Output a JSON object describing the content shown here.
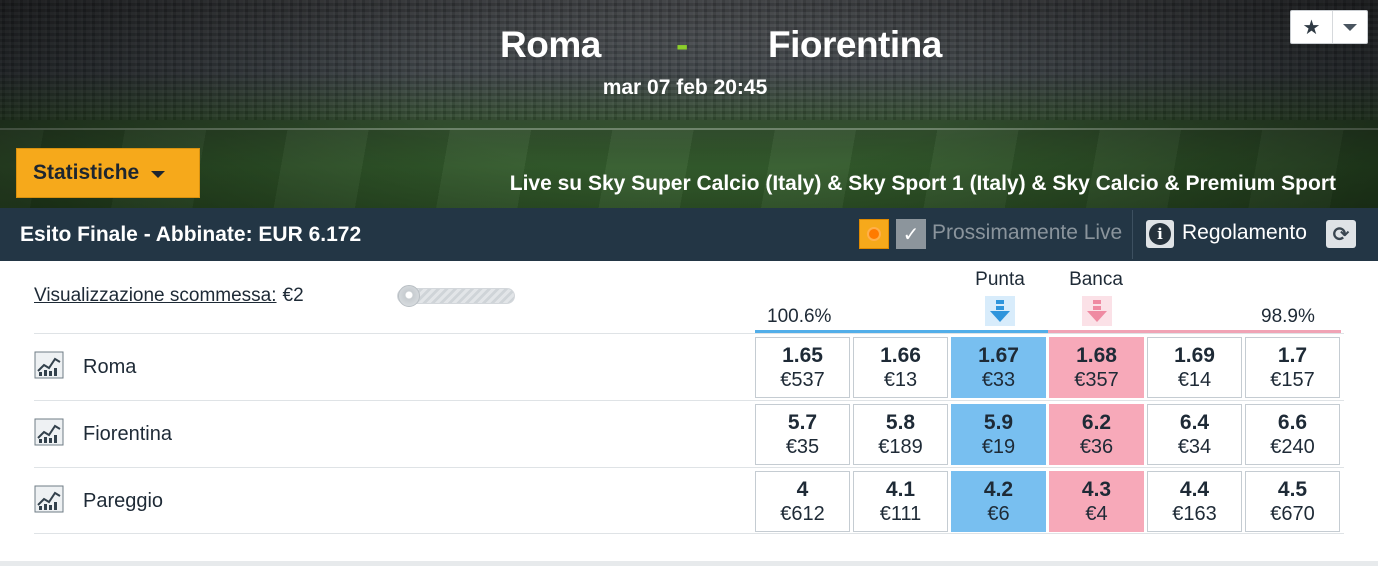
{
  "header": {
    "home_team": "Roma",
    "separator": "-",
    "away_team": "Fiorentina",
    "date": "mar 07 feb 20:45",
    "stats_button": "Statistiche",
    "live_info": "Live su Sky Super Calcio (Italy) & Sky Sport 1 (Italy) & Sky Calcio & Premium Sport",
    "fav_icon": "★"
  },
  "market": {
    "title": "Esito Finale - Abbinate: EUR 6.172",
    "soon_live": "Prossimamente Live",
    "rules": "Regolamento",
    "info_glyph": "i",
    "refresh_glyph": "⟳",
    "check_glyph": "✓"
  },
  "controls": {
    "view_label": "Visualizzazione scommessa:",
    "view_value": "€2",
    "slider_level": 0
  },
  "columns": {
    "back": "Punta",
    "lay": "Banca",
    "back_pct": "100.6%",
    "lay_pct": "98.9%"
  },
  "runners": [
    {
      "name": "Roma",
      "prices": [
        {
          "odds": "1.65",
          "stake": "€537"
        },
        {
          "odds": "1.66",
          "stake": "€13"
        },
        {
          "odds": "1.67",
          "stake": "€33"
        },
        {
          "odds": "1.68",
          "stake": "€357"
        },
        {
          "odds": "1.69",
          "stake": "€14"
        },
        {
          "odds": "1.7",
          "stake": "€157"
        }
      ]
    },
    {
      "name": "Fiorentina",
      "prices": [
        {
          "odds": "5.7",
          "stake": "€35"
        },
        {
          "odds": "5.8",
          "stake": "€189"
        },
        {
          "odds": "5.9",
          "stake": "€19"
        },
        {
          "odds": "6.2",
          "stake": "€36"
        },
        {
          "odds": "6.4",
          "stake": "€34"
        },
        {
          "odds": "6.6",
          "stake": "€240"
        }
      ]
    },
    {
      "name": "Pareggio",
      "prices": [
        {
          "odds": "4",
          "stake": "€612"
        },
        {
          "odds": "4.1",
          "stake": "€111"
        },
        {
          "odds": "4.2",
          "stake": "€6"
        },
        {
          "odds": "4.3",
          "stake": "€4"
        },
        {
          "odds": "4.4",
          "stake": "€163"
        },
        {
          "odds": "4.5",
          "stake": "€670"
        }
      ]
    }
  ],
  "colors": {
    "back_best": "#78bff0",
    "lay_best": "#f7a9b9",
    "accent": "#f6a91b",
    "bar": "#233645"
  }
}
